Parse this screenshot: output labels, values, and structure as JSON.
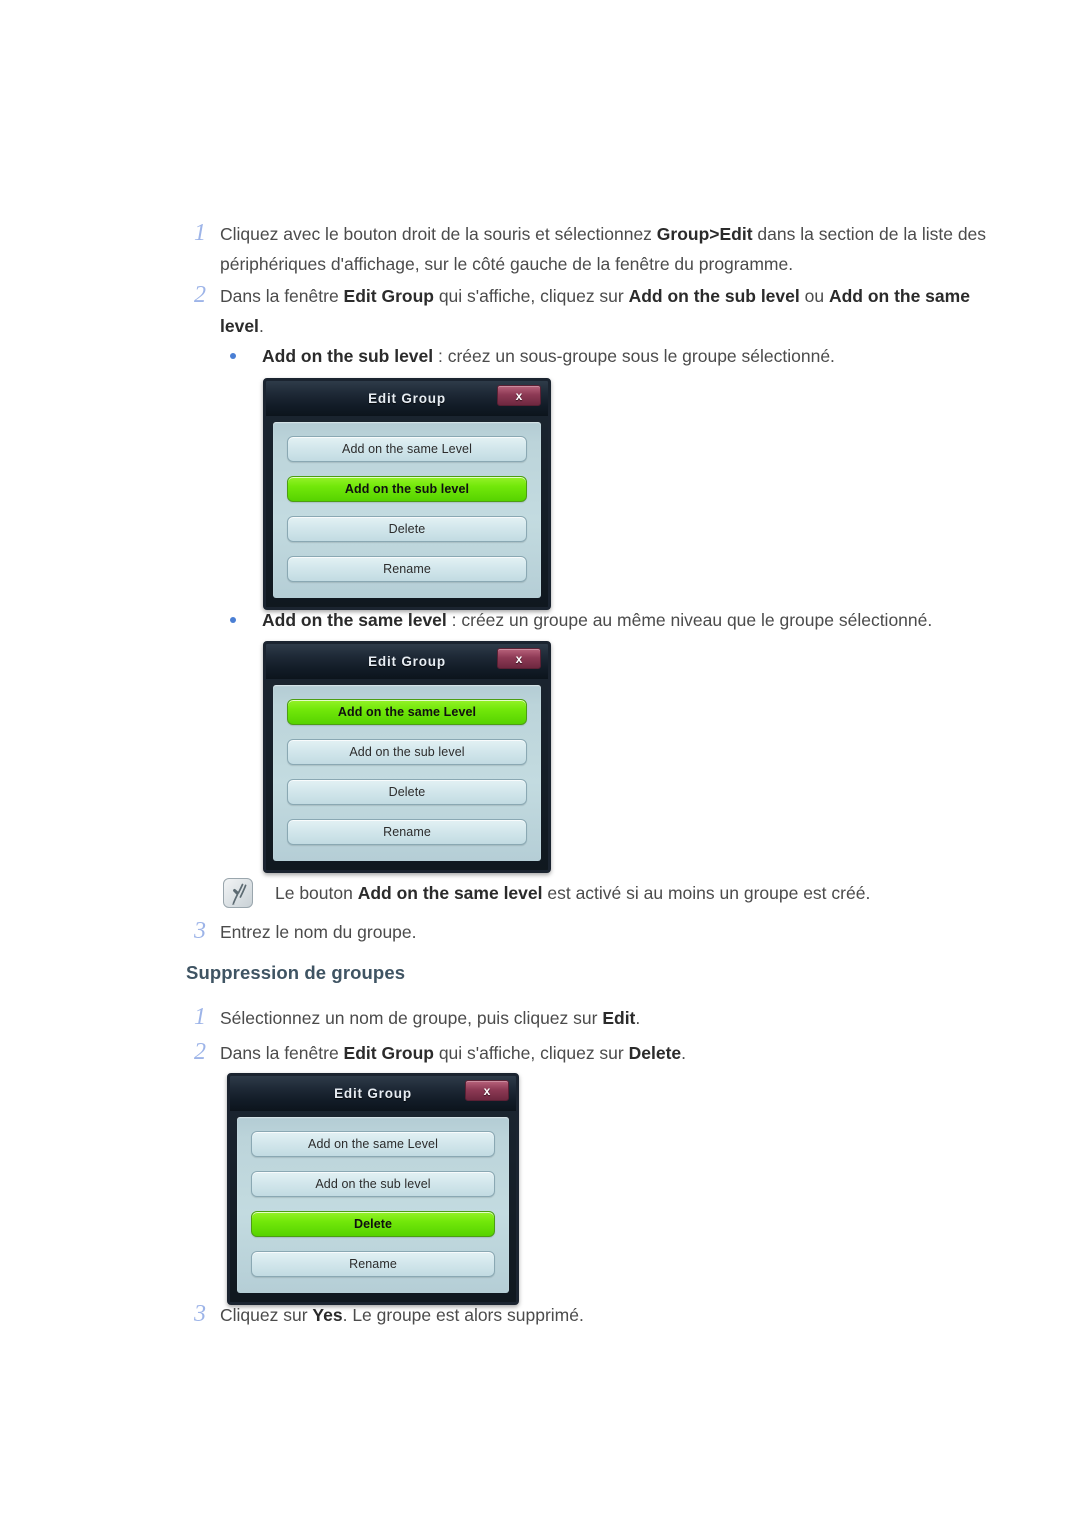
{
  "page": {
    "steps_top": [
      {
        "number": "1",
        "html": "Cliquez avec le bouton droit de la souris et sélectionnez <b>Group>Edit</b> dans la section de la liste des périphériques d'affichage, sur le côté gauche de la fenêtre du programme."
      },
      {
        "number": "2",
        "html": "Dans la fenêtre <b>Edit Group</b> qui s'affiche, cliquez sur <b>Add on the sub level</b> ou <b>Add on the same level</b>."
      }
    ],
    "bullet_sub": {
      "html": "<b>Add on the sub level</b> : créez un sous-groupe sous le groupe sélectionné."
    },
    "bullet_same": {
      "html": "<b>Add on the same level</b> : créez un groupe au même niveau que le groupe sélectionné."
    },
    "note": {
      "icon": "note-pencil-icon",
      "html": "Le bouton <b>Add on the same level</b> est activé si au moins un groupe est créé."
    },
    "step3": {
      "number": "3",
      "html": "Entrez le nom du groupe."
    },
    "section_heading": "Suppression de groupes",
    "steps_delete": [
      {
        "number": "1",
        "html": "Sélectionnez un nom de groupe, puis cliquez sur <b>Edit</b>."
      },
      {
        "number": "2",
        "html": "Dans la fenêtre <b>Edit Group</b> qui s'affiche, cliquez sur <b>Delete</b>."
      },
      {
        "number": "3",
        "html": "Cliquez sur <b>Yes</b>. Le groupe est alors supprimé."
      }
    ]
  },
  "dialogs": [
    {
      "title": "Edit Group",
      "close_label": "x",
      "buttons": [
        {
          "label": "Add on the same Level",
          "active": false
        },
        {
          "label": "Add on the sub level",
          "active": true
        },
        {
          "label": "Delete",
          "active": false
        },
        {
          "label": "Rename",
          "active": false
        }
      ]
    },
    {
      "title": "Edit Group",
      "close_label": "x",
      "buttons": [
        {
          "label": "Add on the same Level",
          "active": true
        },
        {
          "label": "Add on the sub level",
          "active": false
        },
        {
          "label": "Delete",
          "active": false
        },
        {
          "label": "Rename",
          "active": false
        }
      ]
    },
    {
      "title": "Edit Group",
      "close_label": "x",
      "buttons": [
        {
          "label": "Add on the same Level",
          "active": false
        },
        {
          "label": "Add on the sub level",
          "active": false
        },
        {
          "label": "Delete",
          "active": true
        },
        {
          "label": "Rename",
          "active": false
        }
      ]
    }
  ],
  "colors": {
    "step_number": "#9db4e8",
    "body_text": "#4b4b4b",
    "heading": "#3f5463",
    "bullet": "#4a7fd4",
    "dialog_accent_green": "#73e80a",
    "dialog_close_red": "#8e3a55",
    "dialog_panel": "#c3dbe0"
  }
}
